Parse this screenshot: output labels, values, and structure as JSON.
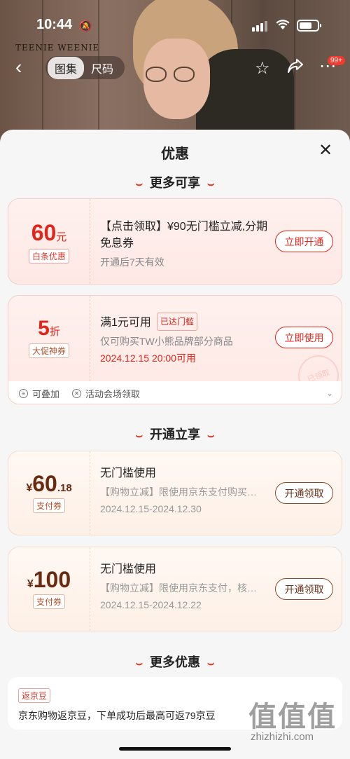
{
  "status_bar": {
    "time": "10:44"
  },
  "header": {
    "brand_text": "TEENIE WEENIE",
    "tabs": [
      {
        "label": "图集"
      },
      {
        "label": "尺码"
      }
    ],
    "cart_badge": "99+"
  },
  "sheet": {
    "title": "优惠",
    "sections": {
      "more": "更多可享",
      "open": "开通立享",
      "other": "更多优惠"
    },
    "coupons_more": [
      {
        "amount": "60",
        "unit": "元",
        "tag": "白条优惠",
        "title": "【点击领取】¥90无门槛立减,分期免息券",
        "sub": "开通后7天有效",
        "button": "立即开通"
      },
      {
        "amount": "5",
        "unit": "折",
        "tag": "大促神券",
        "title": "满1元可用",
        "reached": "已达门槛",
        "sub": "仅可购买TW小熊品牌部分商品",
        "time": "2024.12.15 20:00可用",
        "button": "立即使用",
        "stamp": "已领取",
        "foot_stackable": "可叠加",
        "foot_venue": "活动会场领取"
      }
    ],
    "coupons_open": [
      {
        "currency": "¥",
        "amount": "60",
        "decimal": ".18",
        "tag": "支付券",
        "title": "无门槛使用",
        "sub": "【购物立减】限使用京东支付购买…",
        "date": "2024.12.15-2024.12.30",
        "button": "开通领取"
      },
      {
        "currency": "¥",
        "amount": "100",
        "tag": "支付券",
        "title": "无门槛使用",
        "sub": "【购物立减】限使用京东支付，核…",
        "date": "2024.12.15-2024.12.22",
        "button": "开通领取"
      }
    ],
    "bean": {
      "tag": "返京豆",
      "text": "京东购物返京豆，下单成功后最高可返79京豆"
    }
  },
  "watermark": {
    "logo": "值值值",
    "text": "zhizhizhi.com"
  }
}
